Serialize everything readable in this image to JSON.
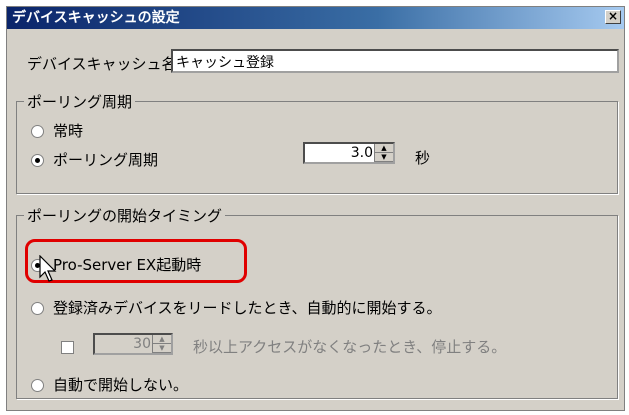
{
  "dialog": {
    "title": "デバイスキャッシュの設定",
    "close_glyph": "×"
  },
  "cache_name": {
    "label": "デバイスキャッシュ名",
    "value": "キャッシュ登録"
  },
  "polling_period": {
    "legend": "ポーリング周期",
    "always_label": "常時",
    "period_label": "ポーリング周期",
    "period_value": "3.0",
    "unit": "秒",
    "selected": "period"
  },
  "polling_start": {
    "legend": "ポーリングの開始タイミング",
    "option_startup": "Pro-Server  EX起動時",
    "option_read": "登録済みデバイスをリードしたとき、自動的に開始する。",
    "stop_seconds": "30",
    "stop_label": "秒以上アクセスがなくなったとき、停止する。",
    "option_manual": "自動で開始しない。",
    "selected": "startup"
  },
  "colors": {
    "highlight": "#e00000",
    "titlebar": "#0a246a"
  }
}
